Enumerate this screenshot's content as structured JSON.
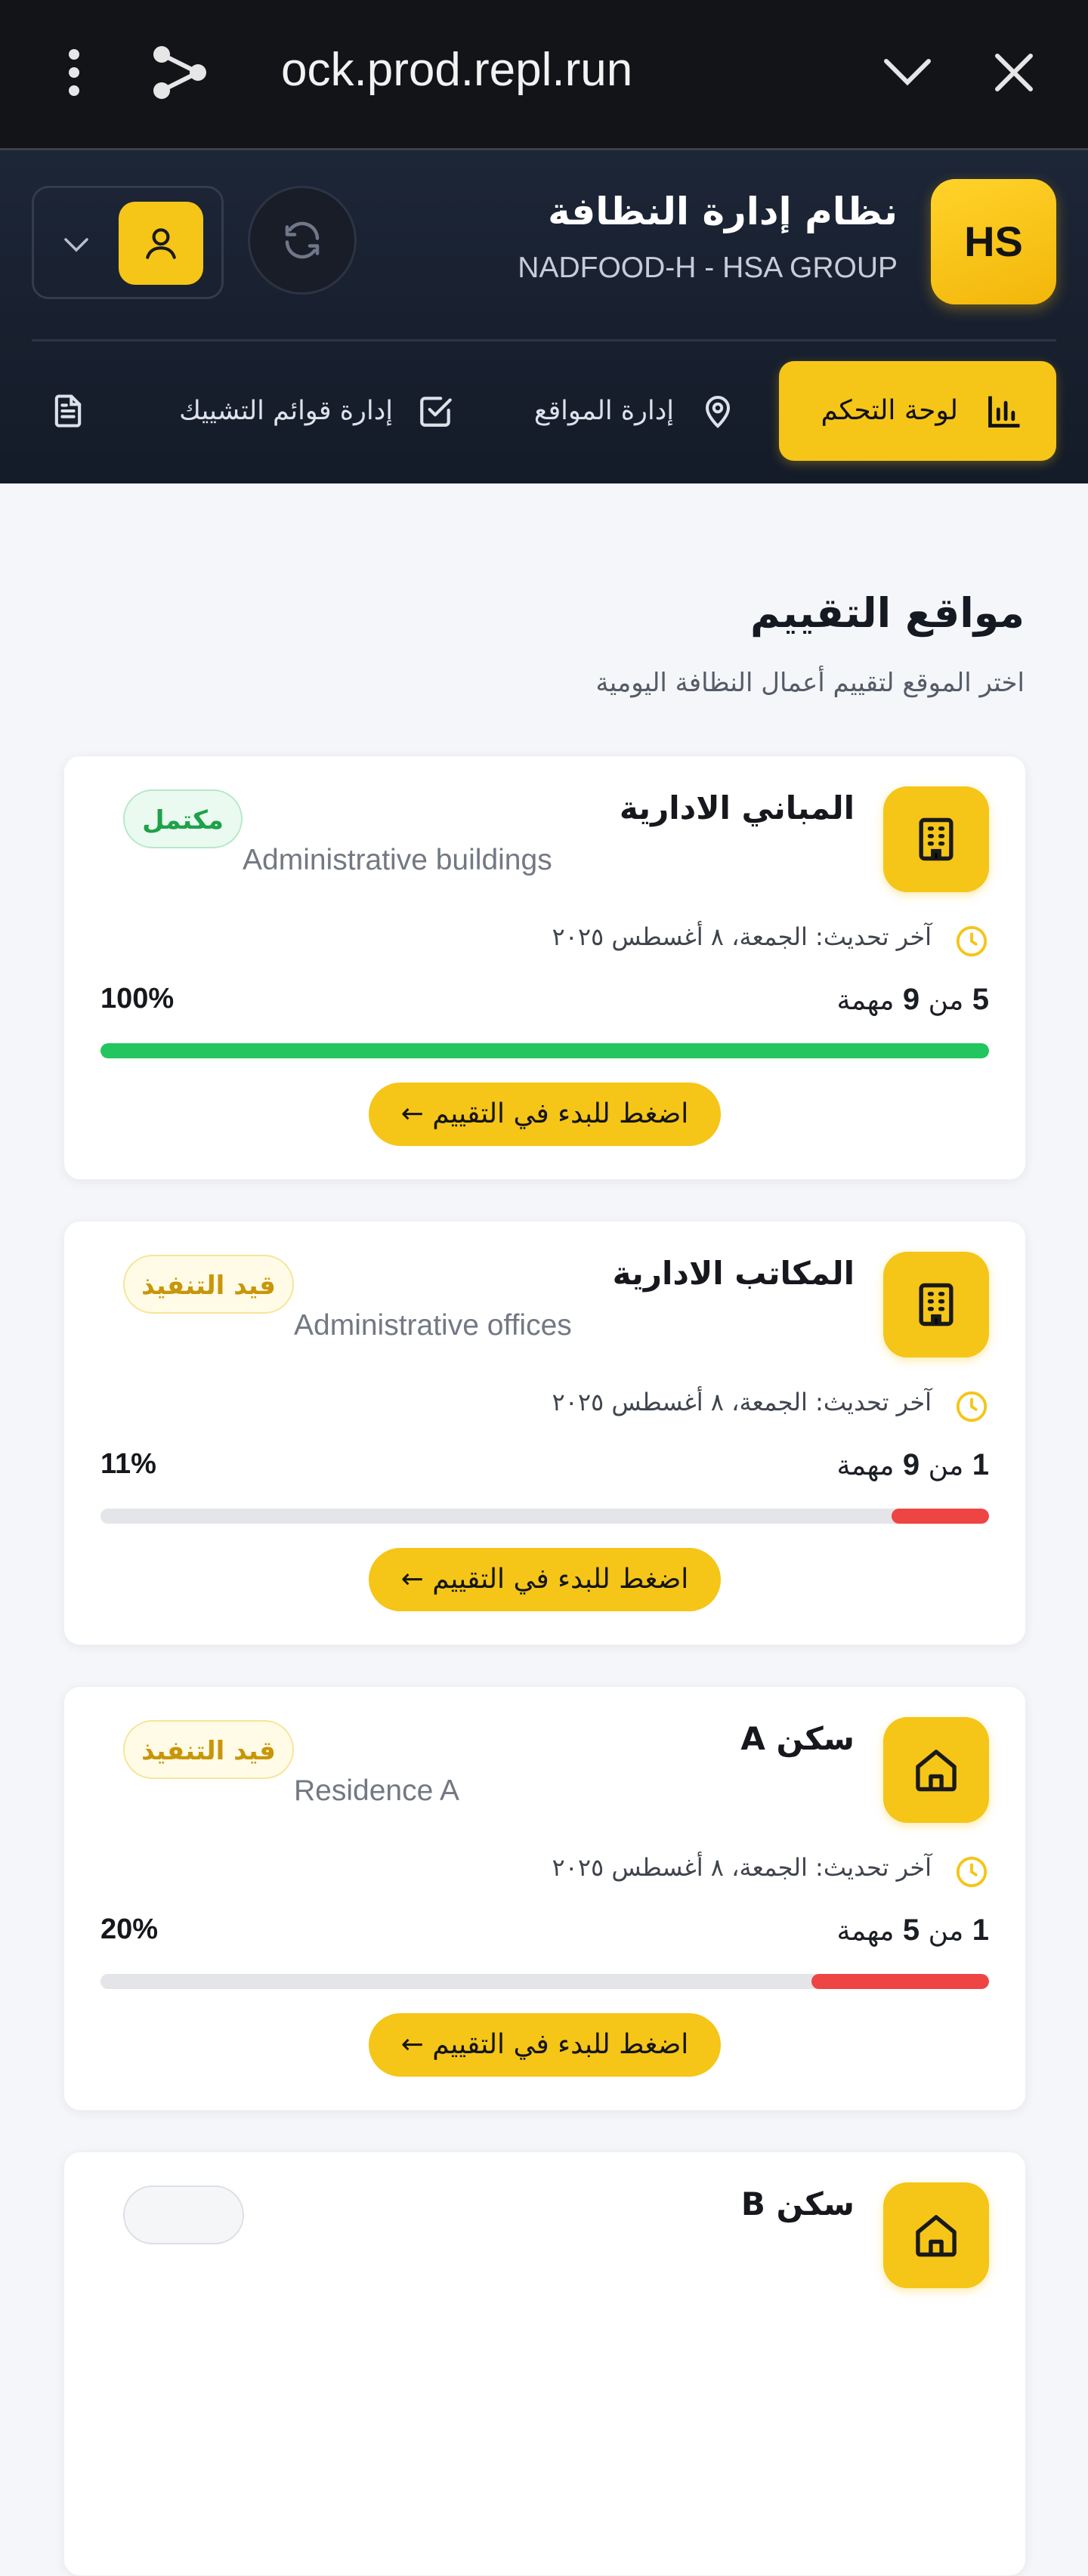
{
  "browser": {
    "url": "ock.prod.repl.run",
    "icons": [
      "more-vert-icon",
      "share-icon",
      "chevron-down-icon",
      "close-icon"
    ]
  },
  "header": {
    "logo_text": "HS",
    "title": "نظام إدارة النظافة",
    "subtitle": "NADFOOD-H - HSA GROUP",
    "nav": [
      {
        "label": "لوحة التحكم",
        "icon": "bar-chart-icon",
        "active": true
      },
      {
        "label": "إدارة المواقع",
        "icon": "map-pin-icon",
        "active": false
      },
      {
        "label": "إدارة قوائم التشييك",
        "icon": "checkbox-icon",
        "active": false
      },
      {
        "label": "",
        "icon": "document-icon",
        "active": false
      }
    ]
  },
  "section": {
    "title": "مواقع التقييم",
    "subtitle": "اختر الموقع لتقييم أعمال النظافة اليومية"
  },
  "colors": {
    "accent": "#f5c518",
    "complete": "#22c55e",
    "low": "#ef4444"
  },
  "locations": [
    {
      "name": "المباني الادارية",
      "name_en": "Administrative buildings",
      "status": "مكتمل",
      "updated": "آخر تحديث: الجمعة، ٨ أغسطس ٢٠٢٥",
      "done": "5",
      "sep": "من",
      "total": "9",
      "tasks_unit": "مهمة",
      "percent_text": "100%",
      "progress": 1.0,
      "button": "اضغط للبدء في التقييم ←",
      "icon": "building-icon"
    },
    {
      "name": "المكاتب الادارية",
      "name_en": "Administrative offices",
      "status": "قيد التنفيذ",
      "updated": "آخر تحديث: الجمعة، ٨ أغسطس ٢٠٢٥",
      "done": "1",
      "sep": "من",
      "total": "9",
      "tasks_unit": "مهمة",
      "percent_text": "11%",
      "progress": 0.11,
      "button": "اضغط للبدء في التقييم ←",
      "icon": "building-icon"
    },
    {
      "name": "سكن A",
      "name_en": "Residence A",
      "status": "قيد التنفيذ",
      "updated": "آخر تحديث: الجمعة، ٨ أغسطس ٢٠٢٥",
      "done": "1",
      "sep": "من",
      "total": "5",
      "tasks_unit": "مهمة",
      "percent_text": "20%",
      "progress": 0.2,
      "button": "اضغط للبدء في التقييم ←",
      "icon": "home-icon"
    },
    {
      "name": "سكن B",
      "status": "",
      "icon": "home-icon"
    }
  ]
}
